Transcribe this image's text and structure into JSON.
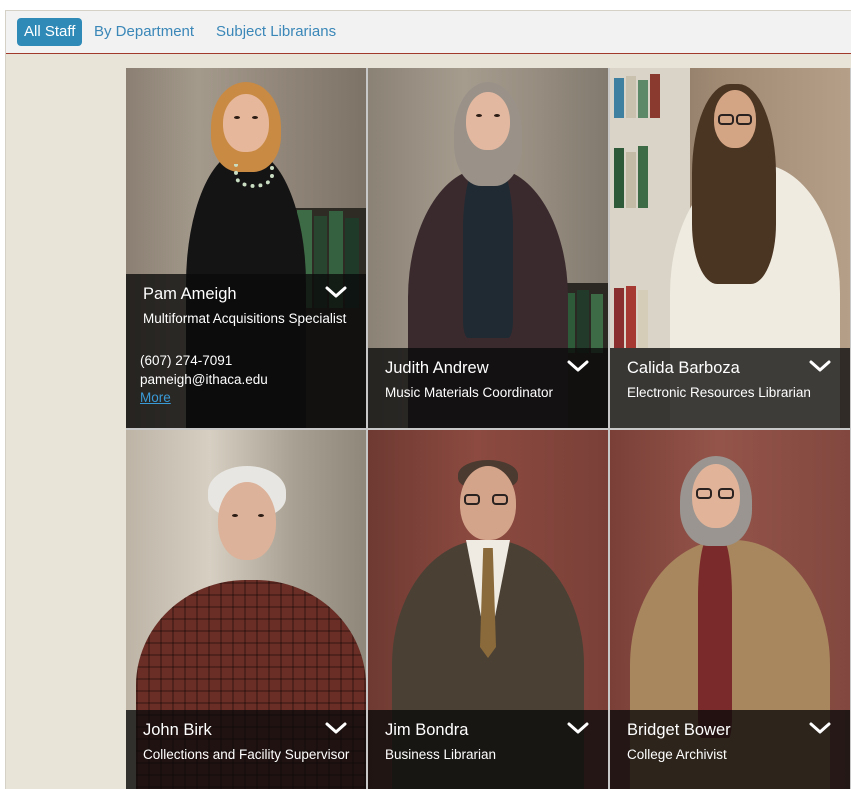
{
  "tabs": [
    {
      "label": "All Staff",
      "active": true
    },
    {
      "label": "By Department",
      "active": false
    },
    {
      "label": "Subject Librarians",
      "active": false
    }
  ],
  "colors": {
    "accent": "#2f8ab8",
    "link": "#3a87b8",
    "divider": "#a23a2c",
    "overlay": "rgba(10,10,10,0.78)"
  },
  "staff": [
    {
      "name": "Pam Ameigh",
      "title": "Multiformat Acquisitions Specialist",
      "phone": "(607) 274-7091",
      "email": "pameigh@ithaca.edu",
      "more_label": "More",
      "expanded": true,
      "chevron_icon": "chevron-down-icon"
    },
    {
      "name": "Judith Andrew",
      "title": "Music Materials Coordinator",
      "expanded": false,
      "chevron_icon": "chevron-down-icon"
    },
    {
      "name": "Calida Barboza",
      "title": "Electronic Resources Librarian",
      "expanded": false,
      "chevron_icon": "chevron-down-icon"
    },
    {
      "name": "John Birk",
      "title": "Collections and Facility Supervisor",
      "expanded": false,
      "chevron_icon": "chevron-down-icon"
    },
    {
      "name": "Jim Bondra",
      "title": "Business Librarian",
      "expanded": false,
      "chevron_icon": "chevron-down-icon"
    },
    {
      "name": "Bridget Bower",
      "title": "College Archivist",
      "expanded": false,
      "chevron_icon": "chevron-down-icon"
    }
  ]
}
